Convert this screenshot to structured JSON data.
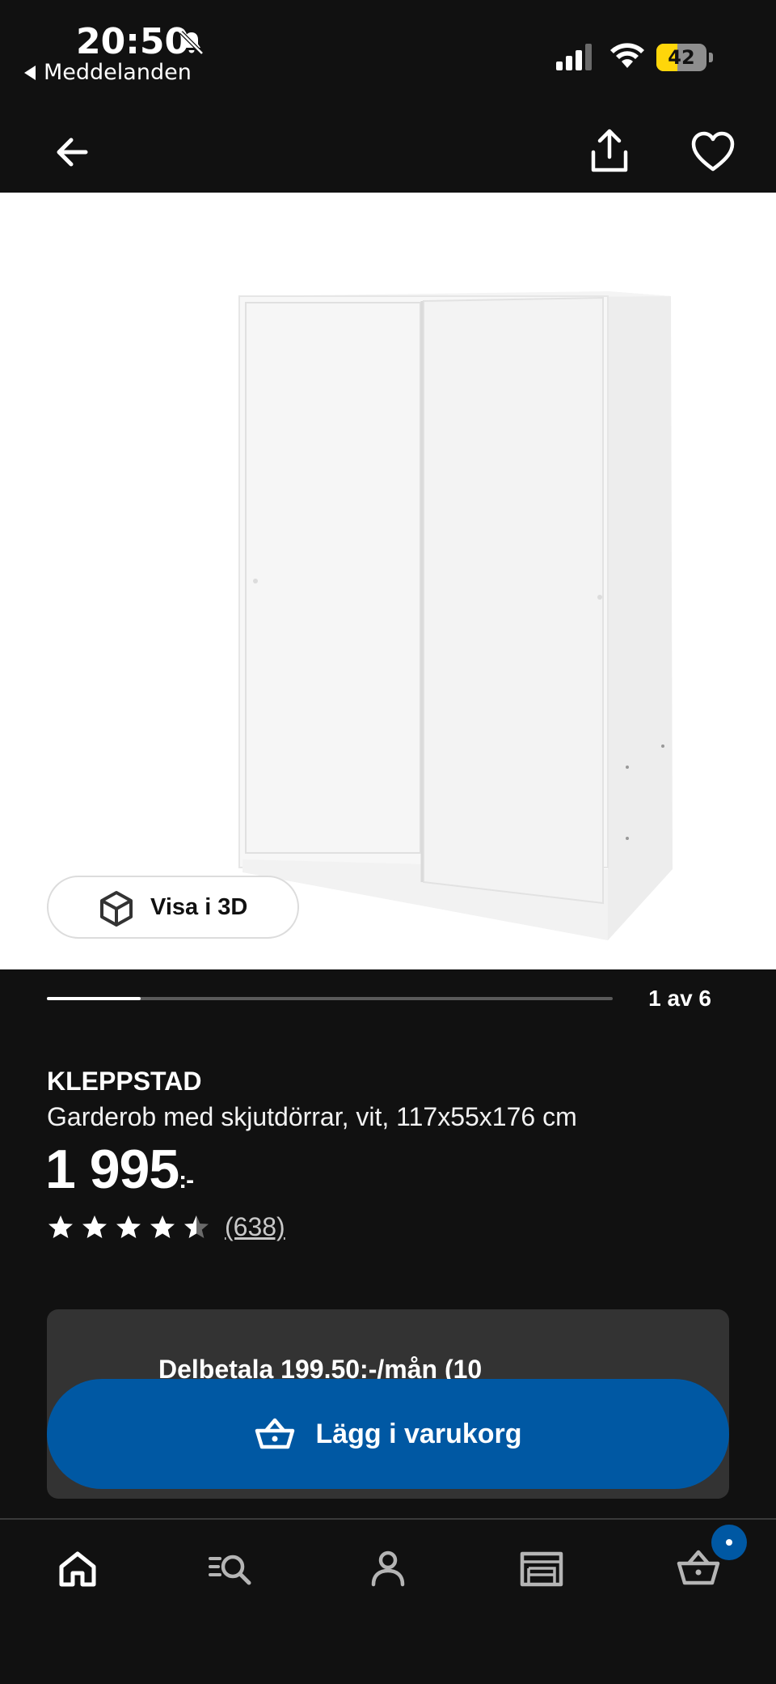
{
  "status_bar": {
    "time": "20:50",
    "back_app_label": "Meddelanden",
    "battery_level": "42",
    "battery_fraction": 0.42,
    "icons": [
      "bell-muted-icon",
      "cellular-signal-icon",
      "wifi-icon",
      "battery-icon"
    ]
  },
  "top_nav": {
    "icons": [
      "back-arrow-icon",
      "share-icon",
      "heart-icon"
    ]
  },
  "product_image": {
    "view_3d_label": "Visa i 3D",
    "progress_fraction": 0.166,
    "counter": "1 av 6"
  },
  "product": {
    "brand": "KLEPPSTAD",
    "description": "Garderob med skjutdörrar, vit, 117x55x176 cm",
    "price": "1 995",
    "price_suffix": ":-",
    "rating_value": 4.5,
    "rating_max": 5,
    "review_count": "(638)"
  },
  "payment": {
    "installment_text": "Delbetala 199.50:-/mån (10"
  },
  "cart_button": {
    "label": "Lägg i varukorg"
  },
  "tab_bar": {
    "items": [
      "home-icon",
      "search-list-icon",
      "profile-icon",
      "store-icon",
      "basket-icon"
    ],
    "basket_badge": true
  },
  "colors": {
    "background": "#111111",
    "accent_blue": "#0058a3",
    "card": "#333333",
    "battery_yellow": "#ffd60a"
  }
}
